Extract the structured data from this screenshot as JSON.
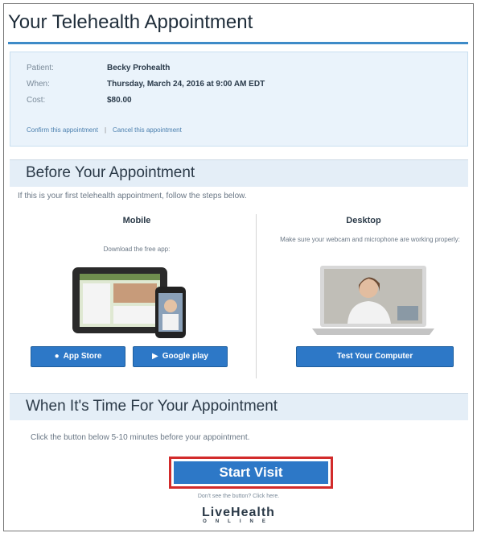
{
  "page_title": "Your Telehealth Appointment",
  "appointment": {
    "patient_label": "Patient:",
    "patient_value": "Becky Prohealth",
    "when_label": "When:",
    "when_value": "Thursday, March 24, 2016 at 9:00 AM EDT",
    "cost_label": "Cost:",
    "cost_value": "$80.00",
    "confirm_link": "Confirm this appointment",
    "separator": "|",
    "cancel_link": "Cancel this appointment"
  },
  "before_section": {
    "heading": "Before Your Appointment",
    "subtext": "If this is your first telehealth appointment, follow the steps below.",
    "mobile": {
      "title": "Mobile",
      "desc": "Download the free app:",
      "app_store_button": "App Store",
      "google_play_button": "Google play"
    },
    "desktop": {
      "title": "Desktop",
      "desc": "Make sure your webcam and microphone are working properly:",
      "test_button": "Test Your Computer"
    }
  },
  "time_section": {
    "heading": "When It's Time For Your Appointment",
    "subtext": "Click the button below 5-10 minutes before your appointment.",
    "start_button": "Start Visit",
    "help_text": "Don't see the button? Click here.",
    "logo_main": "LiveHealth",
    "logo_sub": "ONLINE"
  }
}
